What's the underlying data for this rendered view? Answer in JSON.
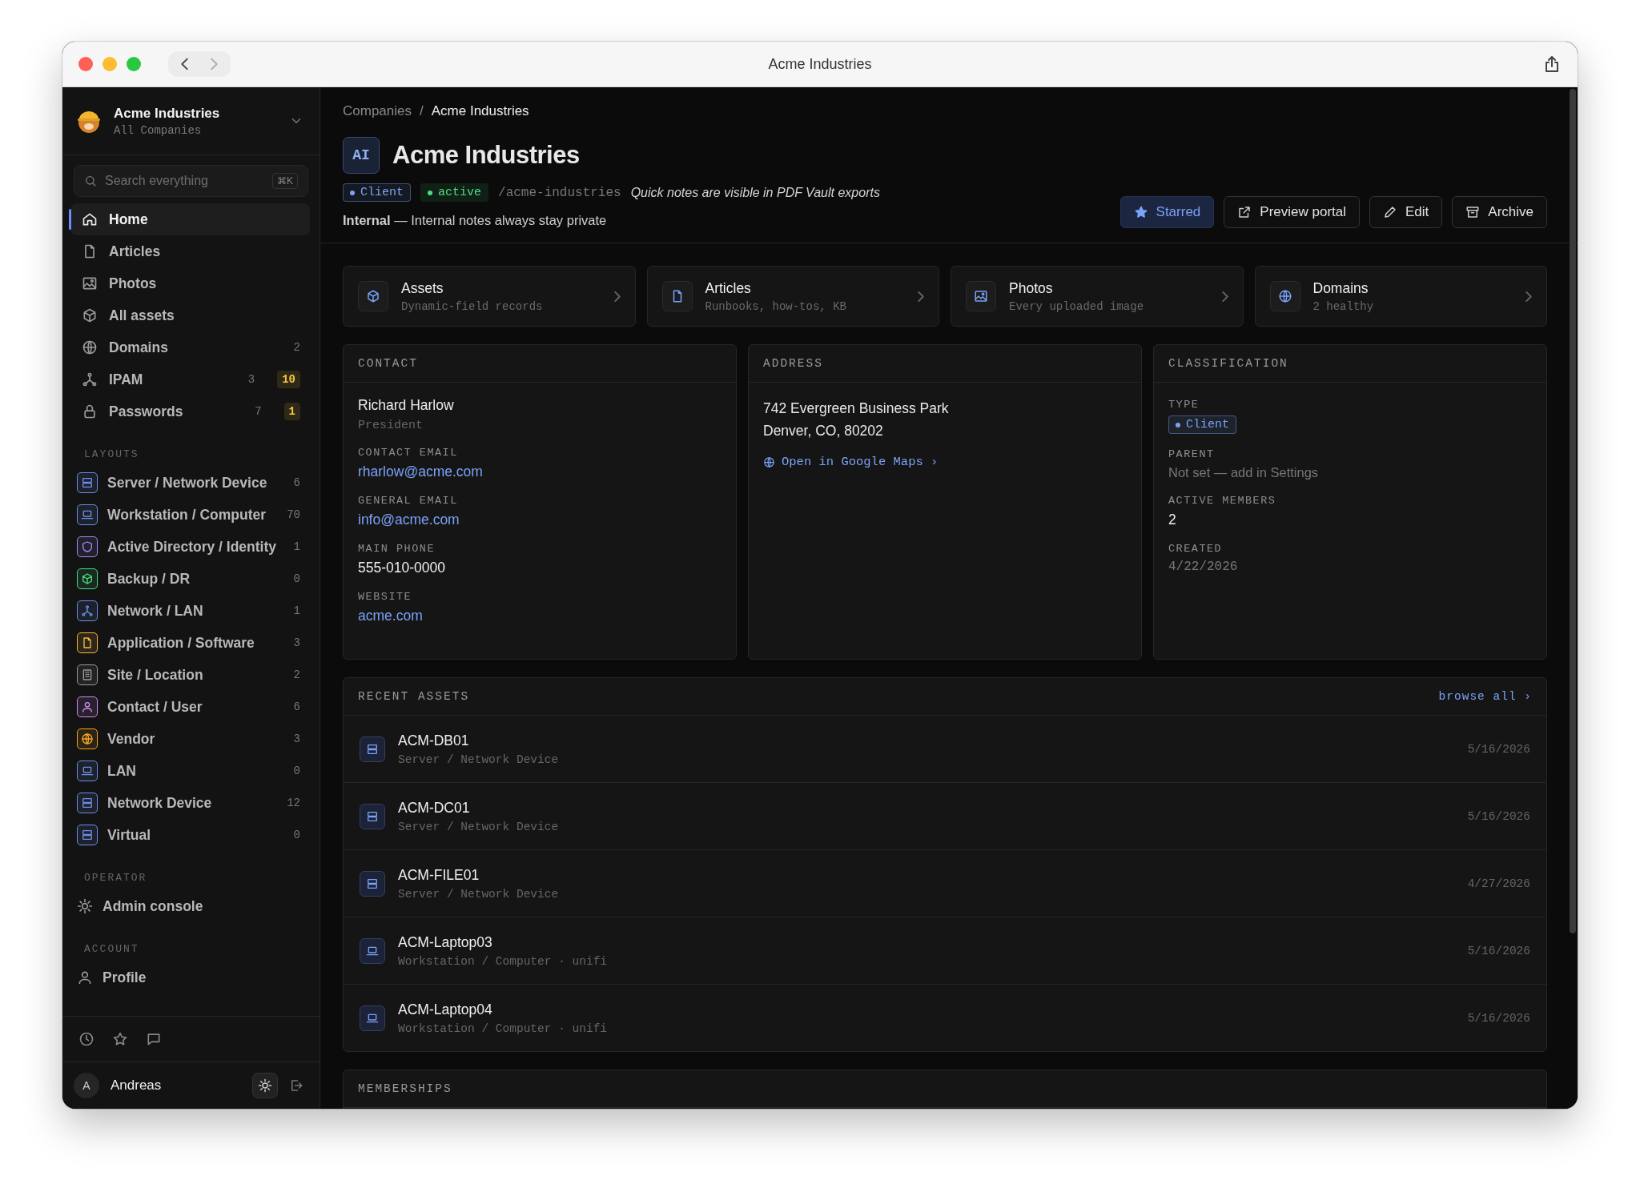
{
  "window": {
    "title": "Acme Industries"
  },
  "sidebar": {
    "company": {
      "name": "Acme Industries",
      "subtitle": "All Companies"
    },
    "search": {
      "placeholder": "Search everything",
      "shortcut": "⌘K"
    },
    "nav": [
      {
        "label": "Home",
        "kind": "home",
        "selected": true
      },
      {
        "label": "Articles",
        "kind": "document",
        "selected": false
      },
      {
        "label": "Photos",
        "kind": "image",
        "selected": false
      },
      {
        "label": "All assets",
        "kind": "cube",
        "selected": false
      },
      {
        "label": "Domains",
        "kind": "globe",
        "count": "2",
        "selected": false
      },
      {
        "label": "IPAM",
        "kind": "network",
        "count": "3",
        "badge": "10",
        "selected": false
      },
      {
        "label": "Passwords",
        "kind": "lock",
        "count": "7",
        "badge": "1",
        "selected": false
      }
    ],
    "sections": [
      {
        "title": "LAYOUTS",
        "items": [
          {
            "label": "Server / Network Device",
            "kind": "server",
            "color": "#6b8fe8",
            "count": "6"
          },
          {
            "label": "Workstation / Computer",
            "kind": "laptop",
            "color": "#6b8fe8",
            "count": "70"
          },
          {
            "label": "Active Directory / Identity",
            "kind": "shield",
            "color": "#a78bfa",
            "count": "1"
          },
          {
            "label": "Backup / DR",
            "kind": "cube",
            "color": "#4ade80",
            "count": "0"
          },
          {
            "label": "Network / LAN",
            "kind": "network",
            "color": "#6b8fe8",
            "count": "1"
          },
          {
            "label": "Application / Software",
            "kind": "document",
            "color": "#f5b942",
            "count": "3"
          },
          {
            "label": "Site / Location",
            "kind": "grid",
            "color": "#9a9a9a",
            "count": "2"
          },
          {
            "label": "Contact / User",
            "kind": "person",
            "color": "#d08cf0",
            "count": "6"
          },
          {
            "label": "Vendor",
            "kind": "globe",
            "color": "#f5a623",
            "count": "3"
          },
          {
            "label": "LAN",
            "kind": "laptop",
            "color": "#6b8fe8",
            "count": "0"
          },
          {
            "label": "Network Device",
            "kind": "server",
            "color": "#6b8fe8",
            "count": "12"
          },
          {
            "label": "Virtual",
            "kind": "server",
            "color": "#6b8fe8",
            "count": "0"
          }
        ]
      },
      {
        "title": "OPERATOR",
        "items": [
          {
            "label": "Admin console",
            "kind": "sun"
          }
        ]
      },
      {
        "title": "ACCOUNT",
        "items": [
          {
            "label": "Profile",
            "kind": "person"
          }
        ]
      }
    ],
    "user": {
      "initial": "A",
      "name": "Andreas"
    }
  },
  "main": {
    "breadcrumb": [
      "Companies",
      "Acme Industries"
    ],
    "breadcrumb_separator": "/",
    "avatar": "AI",
    "title": "Acme Industries",
    "tags": [
      {
        "label": "Client",
        "color": "#7aa2f7"
      },
      {
        "label": "active",
        "color": "#4ade80"
      }
    ],
    "slug": "/acme-industries",
    "note": "Quick notes are visible in PDF Vault exports",
    "internal": "**Internal** — Internal notes always stay private",
    "buttons": [
      {
        "label": "Starred",
        "kind": "star",
        "on": true
      },
      {
        "label": "Preview portal",
        "kind": "external",
        "on": false
      },
      {
        "label": "Edit",
        "kind": "pencil",
        "on": false
      },
      {
        "label": "Archive",
        "kind": "archive",
        "on": false
      }
    ],
    "quick_links": [
      {
        "title": "Assets",
        "subtitle": "Dynamic-field records",
        "kind": "cube"
      },
      {
        "title": "Articles",
        "subtitle": "Runbooks, how-tos, KB",
        "kind": "document"
      },
      {
        "title": "Photos",
        "subtitle": "Every uploaded image",
        "kind": "image"
      },
      {
        "title": "Domains",
        "subtitle": "2 healthy",
        "kind": "globe"
      }
    ],
    "contact": {
      "title": "CONTACT",
      "name": "Richard Harlow",
      "role": "President",
      "fields": [
        {
          "label": "CONTACT EMAIL",
          "value": "rharlow@acme.com",
          "kind": "link"
        },
        {
          "label": "GENERAL EMAIL",
          "value": "info@acme.com",
          "kind": "link"
        },
        {
          "label": "MAIN PHONE",
          "value": "555-010-0000",
          "kind": "text"
        },
        {
          "label": "WEBSITE",
          "value": "acme.com",
          "kind": "link"
        }
      ]
    },
    "address": {
      "title": "ADDRESS",
      "lines": [
        "742 Evergreen Business Park",
        "Denver, CO, 80202"
      ],
      "map_link": "Open in Google Maps ›"
    },
    "classification": {
      "title": "CLASSIFICATION",
      "fields": [
        {
          "label": "TYPE",
          "value": "Client",
          "kind": "tag",
          "color": "#7aa2f7"
        },
        {
          "label": "PARENT",
          "value": "Not set — add in Settings",
          "kind": "muted"
        },
        {
          "label": "ACTIVE MEMBERS",
          "value": "2",
          "kind": "text"
        },
        {
          "label": "CREATED",
          "value": "4/22/2026",
          "kind": "mono"
        }
      ]
    },
    "recent_assets": {
      "title": "RECENT ASSETS",
      "action": "browse all ›",
      "rows": [
        {
          "name": "ACM-DB01",
          "type": "Server / Network Device",
          "date": "5/16/2026",
          "kind": "server"
        },
        {
          "name": "ACM-DC01",
          "type": "Server / Network Device",
          "date": "5/16/2026",
          "kind": "server"
        },
        {
          "name": "ACM-FILE01",
          "type": "Server / Network Device",
          "date": "4/27/2026",
          "kind": "server"
        },
        {
          "name": "ACM-Laptop03",
          "type": "Workstation / Computer · unifi",
          "date": "5/16/2026",
          "kind": "laptop"
        },
        {
          "name": "ACM-Laptop04",
          "type": "Workstation / Computer · unifi",
          "date": "5/16/2026",
          "kind": "laptop"
        }
      ]
    },
    "memberships": {
      "title": "MEMBERSHIPS"
    }
  }
}
